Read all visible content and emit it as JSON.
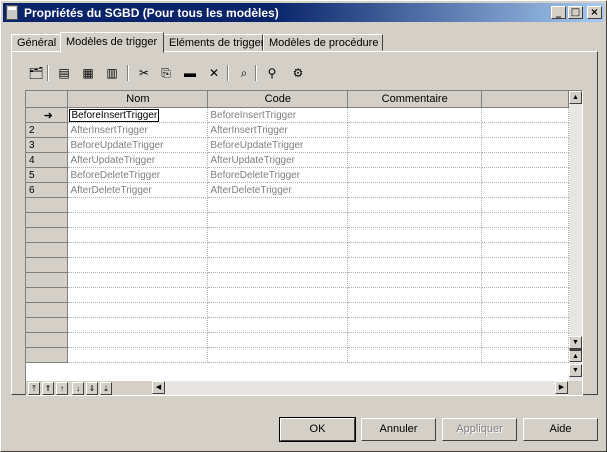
{
  "window": {
    "title": "Propriétés du SGBD (Pour tous les modèles)",
    "controls": [
      "_",
      "□",
      "×"
    ]
  },
  "tabs": [
    {
      "label": "Général"
    },
    {
      "label": "Modèles de trigger"
    },
    {
      "label": "Eléments de trigger"
    },
    {
      "label": "Modèles de procédure"
    }
  ],
  "toolbar": [
    {
      "icon": "properties-icon",
      "glyph": "🗂"
    },
    {
      "icon": "insert-row-icon",
      "glyph": "▤"
    },
    {
      "icon": "add-row-icon",
      "glyph": "▦"
    },
    {
      "icon": "add-from-list-icon",
      "glyph": "▥"
    },
    {
      "icon": "cut-icon",
      "glyph": "✂"
    },
    {
      "icon": "copy-icon",
      "glyph": "⎘"
    },
    {
      "icon": "paste-icon",
      "glyph": "▬"
    },
    {
      "icon": "delete-icon",
      "glyph": "✕"
    },
    {
      "icon": "find-icon",
      "glyph": "⌕"
    },
    {
      "icon": "filter-icon",
      "glyph": "⚲"
    },
    {
      "icon": "filter-settings-icon",
      "glyph": "⚙"
    }
  ],
  "grid": {
    "columns": [
      "Nom",
      "Code",
      "Commentaire"
    ],
    "current_marker": "➜",
    "rows": [
      {
        "num": "",
        "name": "BeforeInsertTrigger",
        "code": "BeforeInsertTrigger",
        "comment": ""
      },
      {
        "num": "2",
        "name": "AfterInsertTrigger",
        "code": "AfterInsertTrigger",
        "comment": ""
      },
      {
        "num": "3",
        "name": "BeforeUpdateTrigger",
        "code": "BeforeUpdateTrigger",
        "comment": ""
      },
      {
        "num": "4",
        "name": "AfterUpdateTrigger",
        "code": "AfterUpdateTrigger",
        "comment": ""
      },
      {
        "num": "5",
        "name": "BeforeDeleteTrigger",
        "code": "BeforeDeleteTrigger",
        "comment": ""
      },
      {
        "num": "6",
        "name": "AfterDeleteTrigger",
        "code": "AfterDeleteTrigger",
        "comment": ""
      }
    ],
    "empty_rows": 11
  },
  "buttons": {
    "ok": "OK",
    "cancel": "Annuler",
    "apply": "Appliquer",
    "help": "Aide"
  }
}
